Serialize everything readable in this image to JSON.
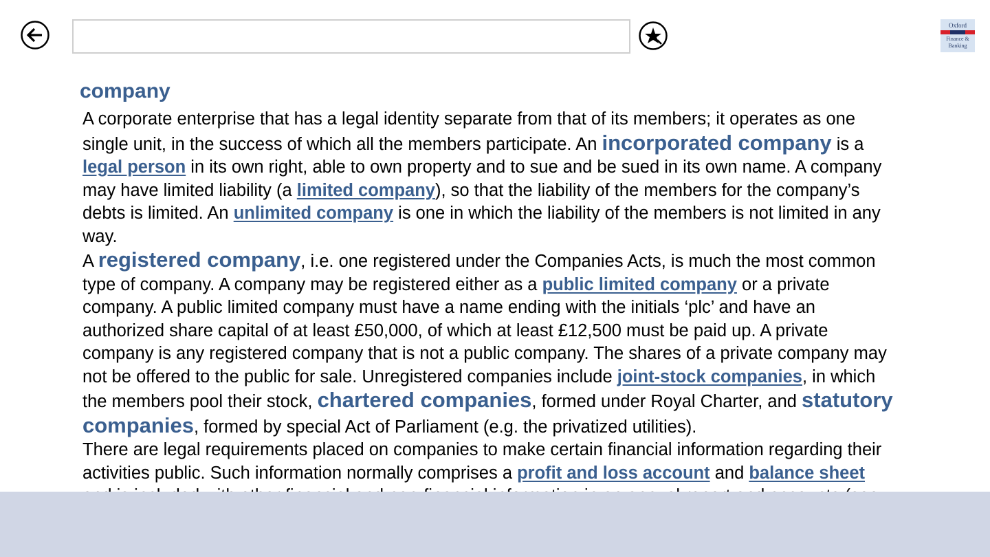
{
  "toolbar": {
    "back_icon": "arrow-left-circle-icon",
    "search_value": "",
    "favorite_icon": "star-circle-icon",
    "logo_line1": "Oxford",
    "logo_line2": "Finance &",
    "logo_line3": "Banking"
  },
  "entry": {
    "headword": "company",
    "para1": {
      "l1": "A corporate enterprise that has a legal identity separate from that of its members; it operates as one",
      "l2a": "single unit, in the success of which all the members participate. An ",
      "l2term": "incorporated company",
      "l2b": " is a",
      "l3link": "legal person",
      "l3b": " in its own right, able to own property and to sue and be sued in its own name. A company",
      "l4a": "may have limited liability (a ",
      "l4link": "limited company",
      "l4b": "), so that the liability of the members for the company’s",
      "l5a": "debts is limited. An ",
      "l5link": "unlimited company",
      "l5b": " is one in which the liability of the members is not limited in any",
      "l6": "way."
    },
    "para2": {
      "l1a": "A ",
      "l1term": "registered company",
      "l1b": ", i.e. one registered under the Companies Acts, is much the most common",
      "l2a": "type of company. A company may be registered either as a ",
      "l2link": "public limited company",
      "l2b": " or a private",
      "l3": "company. A public limited company must have a name ending with the initials ‘plc’ and have an",
      "l4": "authorized share capital of at least £50,000, of which at least £12,500 must be paid up. A private",
      "l5": "company is any registered company that is not a public company. The shares of a private company may",
      "l6a": "not be offered to the public for sale. Unregistered companies include ",
      "l6link": "joint-stock companies",
      "l6b": ", in which",
      "l7a": "the members pool their stock, ",
      "l7term": "chartered companies",
      "l7b": ", formed under Royal Charter, and ",
      "l7term2": "statutory",
      "l8term": "companies",
      "l8b": ", formed by special Act of Parliament (e.g. the privatized utilities)."
    },
    "para3": {
      "l1": "There are legal requirements placed on companies to make certain financial information regarding their",
      "l2a": "activities public. Such information normally comprises a ",
      "l2link": "profit and loss account",
      "l2b": " and ",
      "l2link2": "balance sheet",
      "l3": "and is included with other financial and non-financial information in an annual report and accounts (see"
    }
  }
}
